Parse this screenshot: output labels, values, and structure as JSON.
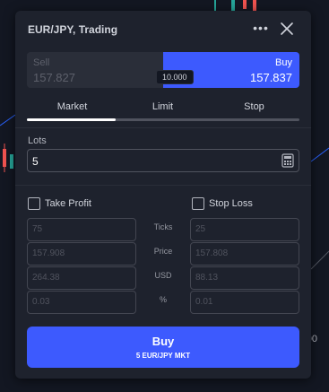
{
  "chart": {
    "axis_value": "00"
  },
  "dialog": {
    "title": "EUR/JPY, Trading",
    "more_glyph": "•••"
  },
  "prices": {
    "sell_label": "Sell",
    "sell_price": "157.827",
    "buy_label": "Buy",
    "buy_price": "157.837",
    "spread": "10.000"
  },
  "tabs": [
    {
      "label": "Market"
    },
    {
      "label": "Limit"
    },
    {
      "label": "Stop"
    }
  ],
  "lots": {
    "label": "Lots",
    "value": "5"
  },
  "take_profit": {
    "label": "Take Profit",
    "checked": false,
    "ticks": "75",
    "price": "157.908",
    "usd": "264.38",
    "percent": "0.03"
  },
  "stop_loss": {
    "label": "Stop Loss",
    "checked": false,
    "ticks": "25",
    "price": "157.808",
    "usd": "88.13",
    "percent": "0.01"
  },
  "row_labels": {
    "ticks": "Ticks",
    "price": "Price",
    "usd": "USD",
    "percent": "%"
  },
  "submit": {
    "label": "Buy",
    "detail": "5 EUR/JPY MKT"
  },
  "colors": {
    "accent": "#3d5afe",
    "panel": "#1e222d",
    "background": "#131722"
  }
}
